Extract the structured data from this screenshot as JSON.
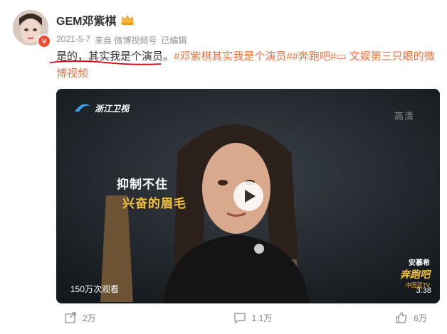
{
  "user": {
    "name": "GEM邓紫棋",
    "verified_badge": "v"
  },
  "meta": {
    "date": "2021-5-7",
    "source": "来自 微博视频号",
    "edited": "已编辑"
  },
  "post": {
    "text_part1": "是的，",
    "text_part2": "其实我是个演员。",
    "tags": "#邓紫棋其实我是个演员##奔跑吧#",
    "link": "文娱第三只眼的微博视频"
  },
  "video": {
    "views": "150万次观看",
    "duration": "3:38",
    "hd_label": "高清",
    "channel": "浙江卫视",
    "caption_line1": "抑制不住",
    "caption_line2": "兴奋的眉毛",
    "show_sponsor": "安慕希",
    "show_name": "奔跑吧",
    "show_sub": "中国蓝TV"
  },
  "actions": {
    "share": "2万",
    "comment": "1.1万",
    "like": "6万"
  },
  "colors": {
    "tag": "#eb7340",
    "underline": "#e0000a",
    "badge": "#f04c2f"
  }
}
